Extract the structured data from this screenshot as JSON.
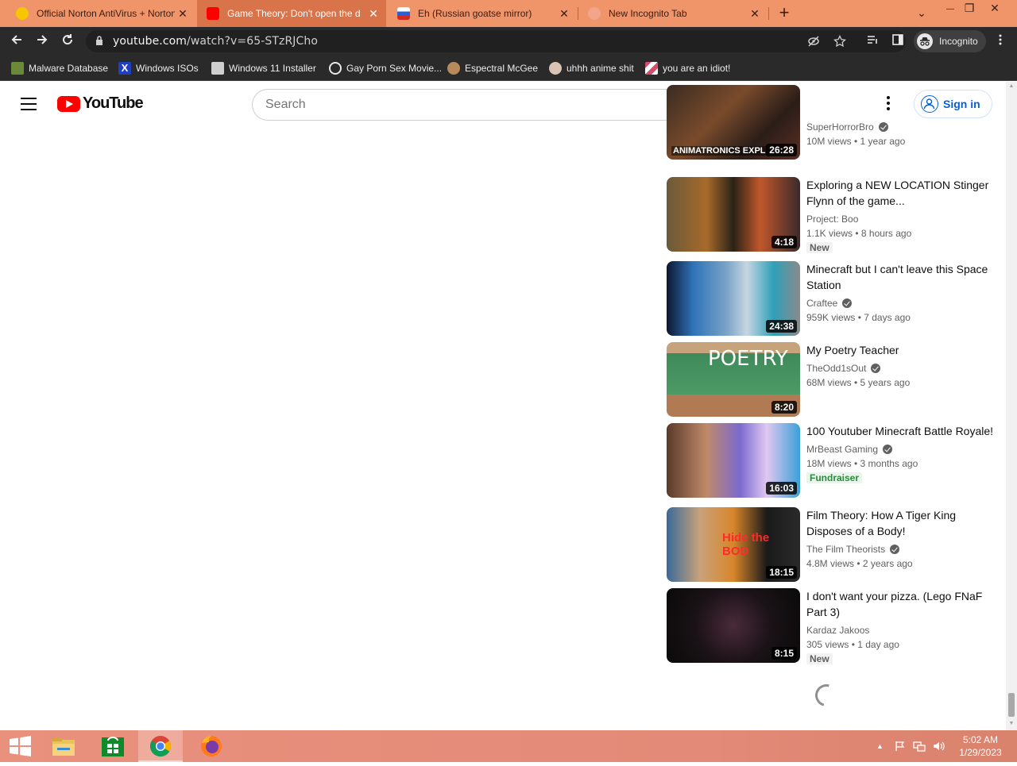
{
  "browser": {
    "tabs": [
      {
        "title": "Official Norton AntiVirus + Norton",
        "active": false
      },
      {
        "title": "Game Theory: Don't open the d",
        "active": true
      },
      {
        "title": "Eh (Russian goatse mirror)",
        "active": false
      },
      {
        "title": "New Incognito Tab",
        "active": false
      }
    ],
    "new_tab": "+",
    "window_controls": {
      "chevron": "⌄",
      "minimize": "—",
      "restore": "❐",
      "close": "✕"
    },
    "url_host": "youtube.com",
    "url_path": "/watch?v=65-STzRJCho",
    "incognito_label": "Incognito",
    "bookmarks": [
      {
        "label": "Malware Database",
        "icon": "malware-icon",
        "color": "#6a8a3a"
      },
      {
        "label": "Windows ISOs",
        "icon": "x-icon",
        "color": "#1f3fbf"
      },
      {
        "label": "Windows 11 Installer",
        "icon": "page-icon",
        "color": "#cfcfcf"
      },
      {
        "label": "Gay Porn Sex Movie...",
        "icon": "pirate-icon",
        "color": "#e8e8e8"
      },
      {
        "label": "Espectral McGee",
        "icon": "face-icon",
        "color": "#b88a5a"
      },
      {
        "label": "uhhh anime shit",
        "icon": "anime-icon",
        "color": "#d9c3b5"
      },
      {
        "label": "you are an idiot!",
        "icon": "flag-icon",
        "color": "#d84a6a"
      }
    ]
  },
  "youtube": {
    "logo_text": "YouTube",
    "search_placeholder": "Search",
    "signin_label": "Sign in",
    "related": [
      {
        "title": "",
        "channel": "SuperHorrorBro",
        "verified": true,
        "stats": "10M views • 1 year ago",
        "duration": "26:28",
        "badge": "",
        "thumb_text": "ANIMATRONICS EXPL"
      },
      {
        "title": "Exploring a NEW LOCATION Stinger Flynn of the game...",
        "channel": "Project: Boo",
        "verified": false,
        "stats": "1.1K views • 8 hours ago",
        "duration": "4:18",
        "badge": "New",
        "thumb_text": ""
      },
      {
        "title": "Minecraft but I can't leave this Space Station",
        "channel": "Craftee",
        "verified": true,
        "stats": "959K views • 7 days ago",
        "duration": "24:38",
        "badge": "",
        "thumb_text": ""
      },
      {
        "title": "My Poetry Teacher",
        "channel": "TheOdd1sOut",
        "verified": true,
        "stats": "68M views • 5 years ago",
        "duration": "8:20",
        "badge": "",
        "thumb_text": "POETRY"
      },
      {
        "title": "100 Youtuber Minecraft Battle Royale!",
        "channel": "MrBeast Gaming",
        "verified": true,
        "stats": "18M views • 3 months ago",
        "duration": "16:03",
        "badge": "Fundraiser",
        "thumb_text": ""
      },
      {
        "title": "Film Theory: How A Tiger King Disposes of a Body!",
        "channel": "The Film Theorists",
        "verified": true,
        "stats": "4.8M views • 2 years ago",
        "duration": "18:15",
        "badge": "",
        "thumb_text": "Hide the BOD"
      },
      {
        "title": "I don't want your pizza. (Lego FNaF Part 3)",
        "channel": "Kardaz Jakoos",
        "verified": false,
        "stats": "305 views • 1 day ago",
        "duration": "8:15",
        "badge": "New",
        "thumb_text": ""
      }
    ]
  },
  "taskbar": {
    "apps": [
      "windows-start",
      "file-explorer",
      "microsoft-store",
      "chrome",
      "firefox"
    ],
    "time": "5:02 AM",
    "date": "1/29/2023"
  }
}
